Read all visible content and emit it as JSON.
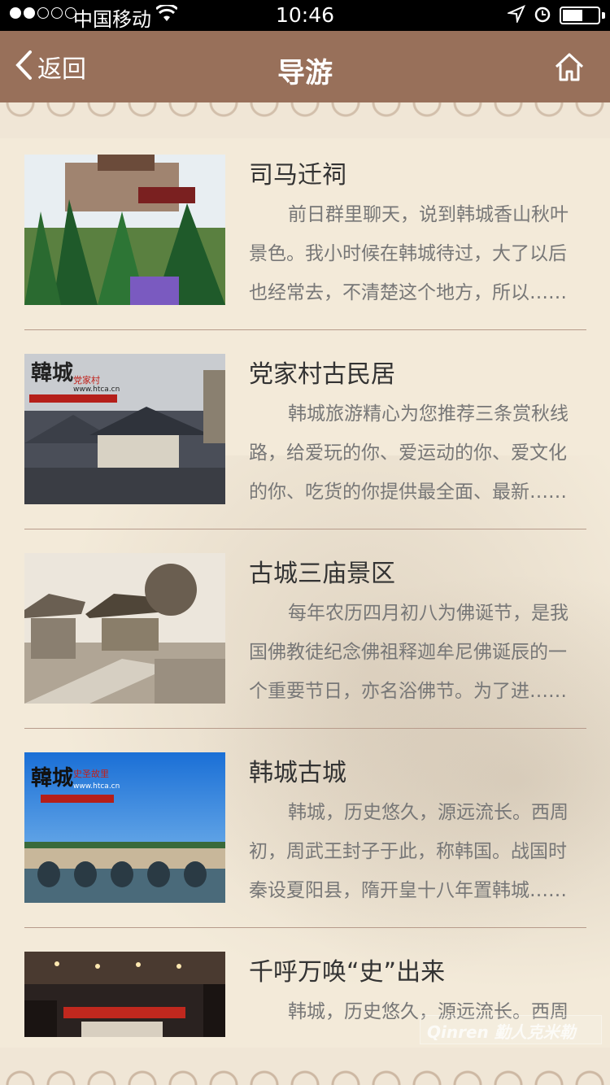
{
  "status_bar": {
    "carrier": "中国移动",
    "time": "10:46"
  },
  "nav": {
    "back_label": "返回",
    "title": "导游",
    "home_icon": "home-icon",
    "back_icon": "chevron-left-icon"
  },
  "items": [
    {
      "title": "司马迁祠",
      "desc": "前日群里聊天，说到韩城香山秋叶景色。我小时候在韩城待过，大了以后也经常去，不清楚这个地方，所以……"
    },
    {
      "title": "党家村古民居",
      "desc": "韩城旅游精心为您推荐三条赏秋线路，给爱玩的你、爱运动的你、爱文化的你、吃货的你提供最全面、最新……",
      "thumb_text": "韓城",
      "thumb_sub": "党家村",
      "thumb_url": "www.htca.cn"
    },
    {
      "title": "古城三庙景区",
      "desc": "每年农历四月初八为佛诞节，是我国佛教徒纪念佛祖释迦牟尼佛诞辰的一个重要节日，亦名浴佛节。为了进……"
    },
    {
      "title": "韩城古城",
      "desc": "韩城，历史悠久，源远流长。西周初，周武王封子于此，称韩国。战国时秦设夏阳县，隋开皇十八年置韩城……",
      "thumb_text": "韓城",
      "thumb_sub": "史圣故里",
      "thumb_url": "www.htca.cn"
    },
    {
      "title": "千呼万唤“史”出来",
      "desc": "韩城，历史悠久，源远流长。西周"
    }
  ],
  "watermark": "Qinren 勤人克米勒",
  "colors": {
    "nav_bg": "#98705a",
    "page_bg": "#f3ead9",
    "divider": "#b79b8b"
  }
}
